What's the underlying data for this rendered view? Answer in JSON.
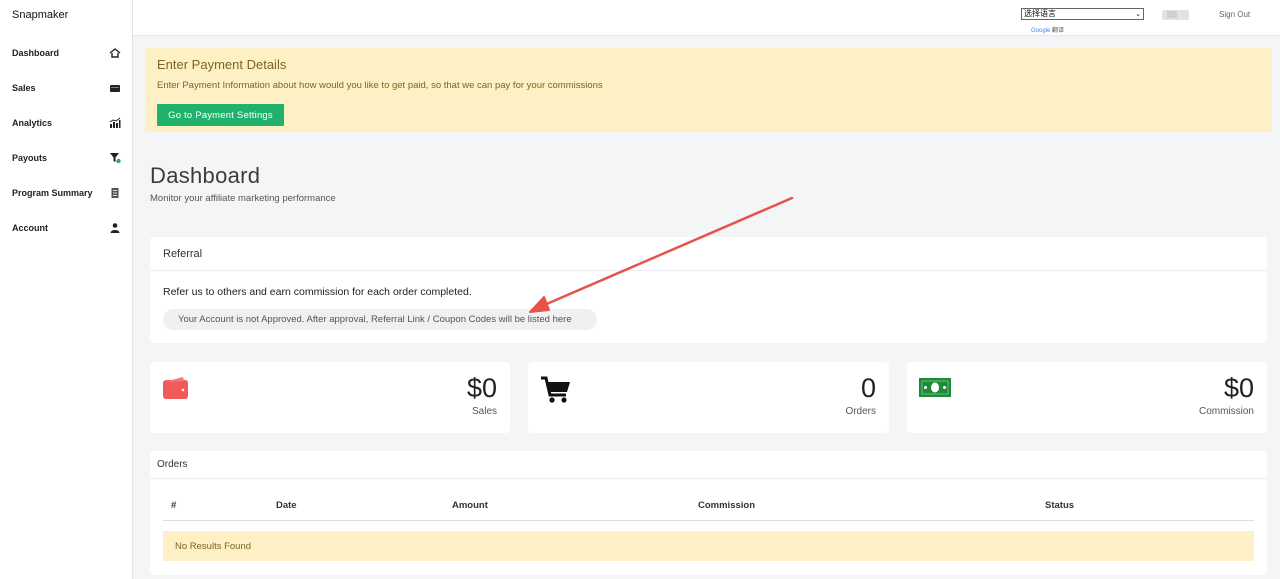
{
  "sidebar": {
    "brand": "Snapmaker",
    "items": [
      {
        "label": "Dashboard",
        "icon": "home-icon"
      },
      {
        "label": "Sales",
        "icon": "wallet-icon"
      },
      {
        "label": "Analytics",
        "icon": "chart-icon"
      },
      {
        "label": "Payouts",
        "icon": "filter-icon"
      },
      {
        "label": "Program Summary",
        "icon": "document-icon"
      },
      {
        "label": "Account",
        "icon": "user-icon"
      }
    ]
  },
  "topbar": {
    "language_select": "选择语言",
    "google_prefix": "Google",
    "google_suffix": "翻译",
    "sign_out": "Sign Out"
  },
  "banner": {
    "title": "Enter Payment Details",
    "text": "Enter Payment Information about how would you like to get paid, so that we can pay for your commissions",
    "button": "Go to Payment Settings"
  },
  "page": {
    "title": "Dashboard",
    "subtitle": "Monitor your affiliate marketing performance"
  },
  "referral": {
    "title": "Referral",
    "text": "Refer us to others and earn commission for each order completed.",
    "notice": "Your Account is not Approved. After approval, Referral Link / Coupon Codes will be listed here"
  },
  "stats": [
    {
      "value": "$0",
      "label": "Sales",
      "icon": "wallet-icon"
    },
    {
      "value": "0",
      "label": "Orders",
      "icon": "cart-icon"
    },
    {
      "value": "$0",
      "label": "Commission",
      "icon": "money-icon"
    }
  ],
  "orders": {
    "title": "Orders",
    "columns": [
      "#",
      "Date",
      "Amount",
      "Commission",
      "Status"
    ],
    "empty": "No Results Found"
  },
  "colors": {
    "accent_green": "#20b26b",
    "banner_bg": "#fcf0c4",
    "banner_text": "#806520",
    "wallet_red": "#f05a5a",
    "money_green": "#1f8a3a",
    "annotation_red": "#e5534b"
  }
}
